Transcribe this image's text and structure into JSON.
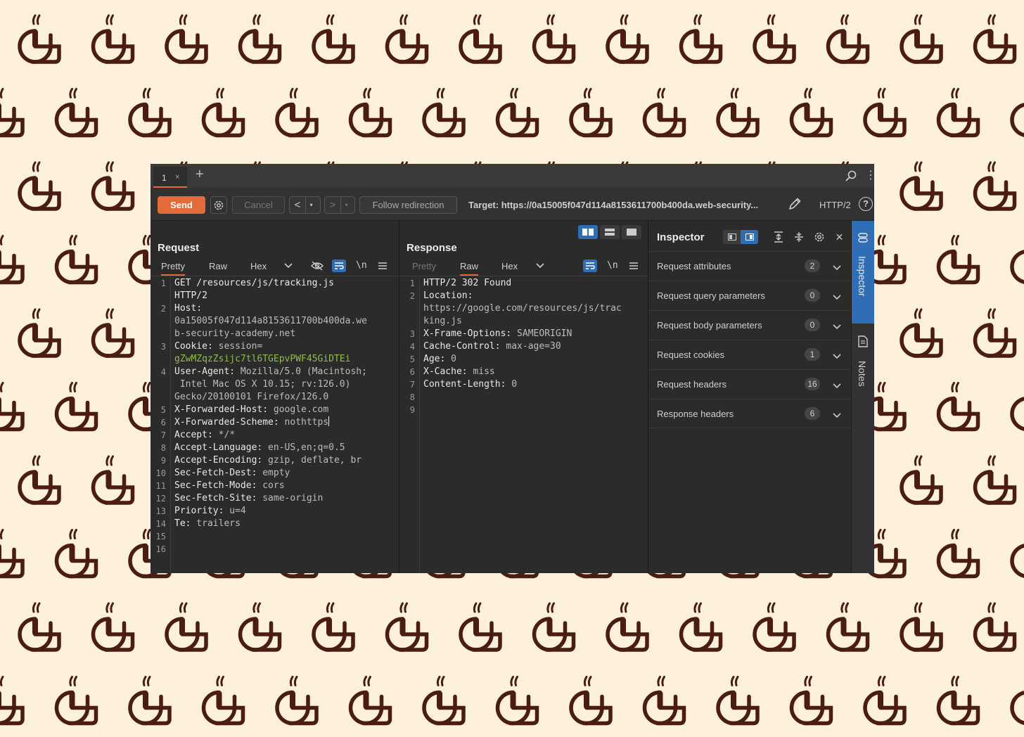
{
  "colors": {
    "background": "#fdf0dd",
    "pattern": "#4a1c12",
    "accent": "#e36b3a",
    "selected_blue": "#2f6db5"
  },
  "tabbar": {
    "tab_label": "1",
    "tab_close": "×",
    "add_tab": "+",
    "more": "⋮"
  },
  "toolbar": {
    "send_label": "Send",
    "cancel_label": "Cancel",
    "prev": "<",
    "next": ">",
    "dropdown": "▾",
    "follow_label": "Follow redirection",
    "target": "Target: https://0a15005f047d114a8153611700b400da.web-security...",
    "protocol": "HTTP/2",
    "help": "?"
  },
  "request": {
    "title": "Request",
    "tabs": [
      "Pretty",
      "Raw",
      "Hex"
    ],
    "newline_toggle": "\\n",
    "lines": [
      {
        "n": "1",
        "key": "GET /resources/js/tracking.js",
        "val": ""
      },
      {
        "n": "",
        "key": "HTTP/2",
        "val": ""
      },
      {
        "n": "2",
        "key": "Host:",
        "val": ""
      },
      {
        "n": "",
        "key": "",
        "val": "0a15005f047d114a8153611700b400da.we"
      },
      {
        "n": "",
        "key": "",
        "val": "b-security-academy.net"
      },
      {
        "n": "3",
        "key": "Cookie:",
        "val": " session="
      },
      {
        "n": "",
        "key": "",
        "val": "gZwMZqzZsijc7tl6TGEpvPWF45GiDTEi",
        "green": true
      },
      {
        "n": "4",
        "key": "User-Agent:",
        "val": " Mozilla/5.0 (Macintosh;"
      },
      {
        "n": "",
        "key": "",
        "val": " Intel Mac OS X 10.15; rv:126.0)"
      },
      {
        "n": "",
        "key": "",
        "val": "Gecko/20100101 Firefox/126.0"
      },
      {
        "n": "5",
        "key": "X-Forwarded-Host:",
        "val": " google.com"
      },
      {
        "n": "6",
        "key": "X-Forwarded-Scheme:",
        "val": " nothttps",
        "cursor": true,
        "highlight": true
      },
      {
        "n": "7",
        "key": "Accept:",
        "val": " */*"
      },
      {
        "n": "8",
        "key": "Accept-Language:",
        "val": " en-US,en;q=0.5"
      },
      {
        "n": "9",
        "key": "Accept-Encoding:",
        "val": " gzip, deflate, br"
      },
      {
        "n": "10",
        "key": "Sec-Fetch-Dest:",
        "val": " empty"
      },
      {
        "n": "11",
        "key": "Sec-Fetch-Mode:",
        "val": " cors"
      },
      {
        "n": "12",
        "key": "Sec-Fetch-Site:",
        "val": " same-origin"
      },
      {
        "n": "13",
        "key": "Priority:",
        "val": " u=4"
      },
      {
        "n": "14",
        "key": "Te:",
        "val": " trailers"
      },
      {
        "n": "15",
        "key": "",
        "val": ""
      },
      {
        "n": "16",
        "key": "",
        "val": ""
      }
    ]
  },
  "response": {
    "title": "Response",
    "tabs": [
      "Pretty",
      "Raw",
      "Hex"
    ],
    "newline_toggle": "\\n",
    "lines": [
      {
        "n": "1",
        "key": "HTTP/2 302 Found",
        "val": "",
        "highlight": true
      },
      {
        "n": "2",
        "key": "Location:",
        "val": ""
      },
      {
        "n": "",
        "key": "",
        "val": "https://google.com/resources/js/trac"
      },
      {
        "n": "",
        "key": "",
        "val": "king.js"
      },
      {
        "n": "3",
        "key": "X-Frame-Options:",
        "val": " SAMEORIGIN"
      },
      {
        "n": "4",
        "key": "Cache-Control:",
        "val": " max-age=30"
      },
      {
        "n": "5",
        "key": "Age:",
        "val": " 0"
      },
      {
        "n": "6",
        "key": "X-Cache:",
        "val": " miss"
      },
      {
        "n": "7",
        "key": "Content-Length:",
        "val": " 0"
      },
      {
        "n": "8",
        "key": "",
        "val": ""
      },
      {
        "n": "9",
        "key": "",
        "val": ""
      }
    ]
  },
  "inspector": {
    "title": "Inspector",
    "close": "✕",
    "rows": [
      {
        "label": "Request attributes",
        "count": "2"
      },
      {
        "label": "Request query parameters",
        "count": "0"
      },
      {
        "label": "Request body parameters",
        "count": "0"
      },
      {
        "label": "Request cookies",
        "count": "1"
      },
      {
        "label": "Request headers",
        "count": "16"
      },
      {
        "label": "Response headers",
        "count": "6"
      }
    ]
  },
  "side": {
    "inspector_label": "Inspector",
    "notes_label": "Notes"
  }
}
